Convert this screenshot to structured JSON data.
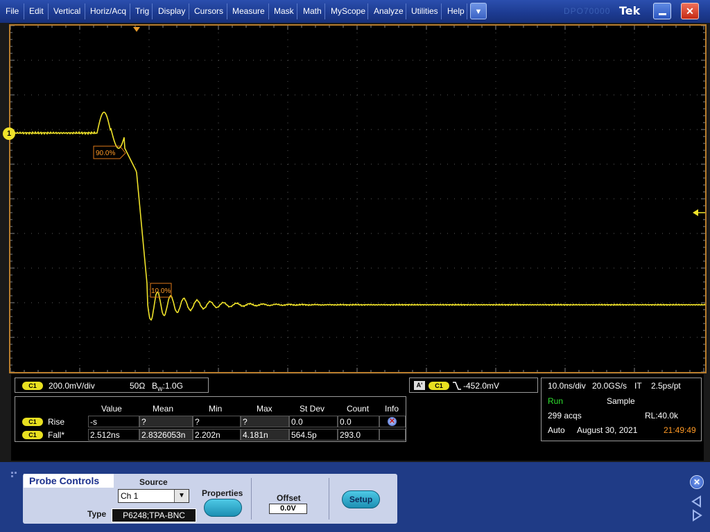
{
  "menu": [
    "File",
    "Edit",
    "Vertical",
    "Horiz/Acq",
    "Trig",
    "Display",
    "Cursors",
    "Measure",
    "Mask",
    "Math",
    "MyScope",
    "Analyze",
    "Utilities",
    "Help"
  ],
  "brand": {
    "logo": "Tek",
    "ghost_text": "DPO70000"
  },
  "waveform": {
    "channel_marker": "1",
    "ref_90_label": "90.0%",
    "ref_10_label": "10.0%",
    "trace_color": "#f0e32a",
    "grid_color": "#5c5c5c",
    "border_color": "#b97d2c"
  },
  "channel_readout": {
    "tag": "C1",
    "scale": "200.0mV/div",
    "impedance": "50Ω",
    "bandwidth_prefix": "B",
    "bandwidth_sub": "W",
    "bandwidth": ":1.0G"
  },
  "trigger_readout": {
    "source_tag": "A'",
    "channel_tag": "C1",
    "slope_icon": "falling-edge-icon",
    "level": "-452.0mV"
  },
  "measurements": {
    "headers": [
      "Value",
      "Mean",
      "Min",
      "Max",
      "St Dev",
      "Count",
      "Info"
    ],
    "rows": [
      {
        "tag": "C1",
        "name": "Rise",
        "value": "-s",
        "mean": "?",
        "min": "?",
        "max": "?",
        "stdev": "0.0",
        "count": "0.0",
        "info_icon": "warning-x-icon"
      },
      {
        "tag": "C1",
        "name": "Fall*",
        "value": "2.512ns",
        "mean": "2.8326053n",
        "min": "2.202n",
        "max": "4.181n",
        "stdev": "564.5p",
        "count": "293.0",
        "info_icon": ""
      }
    ]
  },
  "acquisition": {
    "timebase": "10.0ns/div",
    "sample_rate": "20.0GS/s",
    "mode": "IT",
    "resolution": "2.5ps/pt",
    "state": "Run",
    "acq_mode": "Sample",
    "acqs": "299 acqs",
    "record_length": "RL:40.0k",
    "trigger_mode": "Auto",
    "date": "August 30, 2021",
    "time": "21:49:49"
  },
  "probe_controls": {
    "title": "Probe Controls",
    "source_label": "Source",
    "source_value": "Ch 1",
    "type_label": "Type",
    "type_value": "P6248;TPA-BNC",
    "properties_label": "Properties",
    "offset_label": "Offset",
    "offset_value": "0.0V",
    "setup_label": "Setup"
  }
}
